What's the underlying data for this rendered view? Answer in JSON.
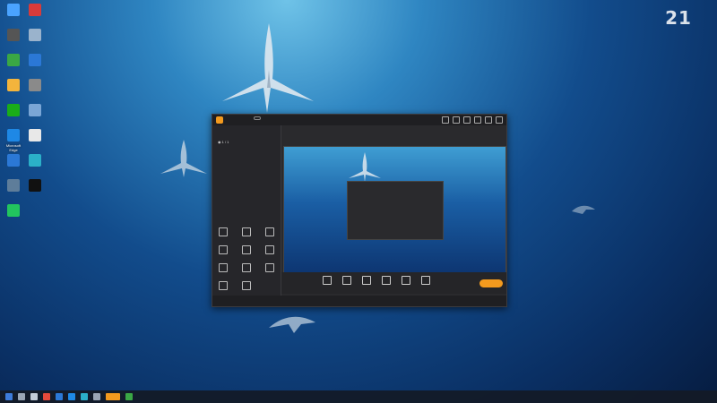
{
  "desktop": {
    "icons": [
      {
        "label": "",
        "color": "#4aa3ff"
      },
      {
        "label": "",
        "color": "#d83b3b"
      },
      {
        "label": "",
        "color": "#555555"
      },
      {
        "label": "",
        "color": "#9ab3cc"
      },
      {
        "label": "",
        "color": "#3aa745"
      },
      {
        "label": "",
        "color": "#2b78d6"
      },
      {
        "label": "",
        "color": "#f3b43c"
      },
      {
        "label": "",
        "color": "#8a8a8a"
      },
      {
        "label": "",
        "color": "#1aad19"
      },
      {
        "label": "",
        "color": "#7aa6d6"
      },
      {
        "label": "Microsoft Edge",
        "color": "#1e88e5"
      },
      {
        "label": "",
        "color": "#e8e8e8"
      },
      {
        "label": "",
        "color": "#2b78d6"
      },
      {
        "label": "",
        "color": "#2bb0c8"
      },
      {
        "label": "",
        "color": "#5e7d9a"
      },
      {
        "label": "",
        "color": "#111111"
      },
      {
        "label": "",
        "color": "#22c55e"
      }
    ]
  },
  "watermark": {
    "big": "21",
    "sub": ""
  },
  "app": {
    "accent": "#f39a1e",
    "tabs": [
      {
        "label": "",
        "active": true
      },
      {
        "label": ""
      },
      {
        "label": ""
      }
    ],
    "scene": {
      "label": "1 / 1"
    },
    "tools_title": "",
    "tools": [
      {
        "label": "",
        "icon": "camera-icon"
      },
      {
        "label": "",
        "icon": "window-icon"
      },
      {
        "label": "",
        "icon": "game-icon"
      },
      {
        "label": "",
        "icon": "film-icon"
      },
      {
        "label": "",
        "icon": "text-icon"
      },
      {
        "label": "",
        "icon": "image-icon"
      },
      {
        "label": "",
        "icon": "cart-icon"
      },
      {
        "label": "",
        "icon": "screen-icon"
      },
      {
        "label": "",
        "icon": "box-icon"
      },
      {
        "label": "",
        "icon": "user-icon"
      },
      {
        "label": "",
        "icon": "more-icon"
      }
    ],
    "room": {
      "title": "",
      "badge": ""
    },
    "bottom_buttons": [
      {
        "label": "",
        "icon": "mic-icon"
      },
      {
        "label": "",
        "icon": "location-icon"
      },
      {
        "label": "",
        "icon": "desktop-icon"
      },
      {
        "label": "",
        "icon": "add-icon"
      },
      {
        "label": "",
        "icon": "headset-icon"
      },
      {
        "label": "",
        "icon": "speaker-icon"
      }
    ],
    "live_button": "",
    "status_message": "",
    "status_right": ""
  },
  "taskbar": {
    "time": "",
    "date": ""
  }
}
